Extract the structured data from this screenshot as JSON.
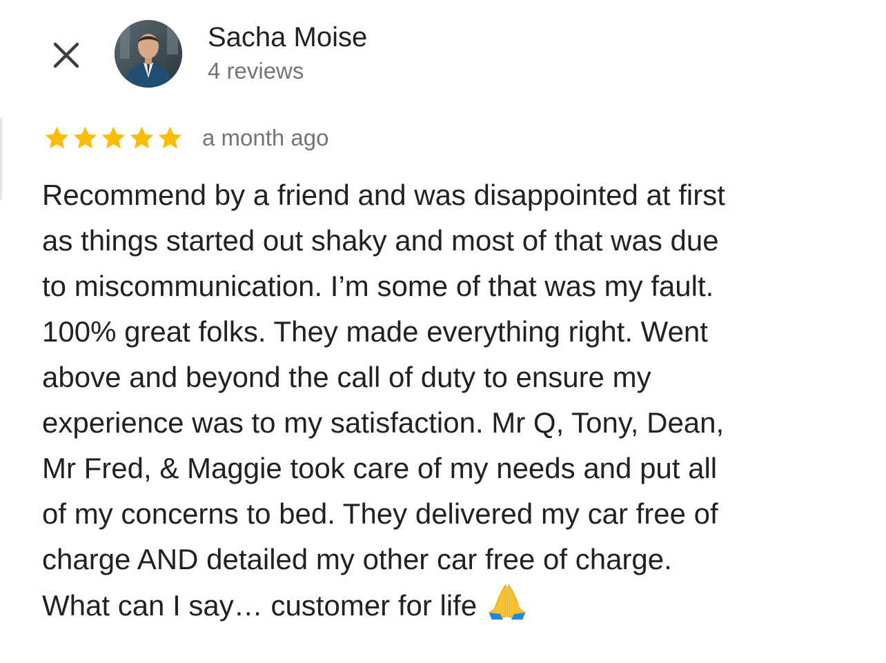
{
  "header": {
    "close_icon": "close-icon",
    "avatar_alt": "reviewer-avatar",
    "reviewer_name": "Sacha Moise",
    "review_count": "4 reviews"
  },
  "review": {
    "rating": 5,
    "rating_max": 5,
    "star_color": "#fbbc04",
    "timestamp": "a month ago",
    "lines": [
      "Recommend by a friend and was disappointed at first",
      "as things started out shaky and most of that was due",
      "to miscommunication. I’m some of that was my fault.",
      "100% great folks. They made everything right. Went",
      "above and beyond the call of duty to ensure my",
      "experience was to my satisfaction. Mr Q, Tony, Dean,",
      "Mr Fred, & Maggie took care of my needs and put all",
      "of my concerns to bed. They delivered my car free of",
      "charge AND detailed my other car free of charge.",
      "What can I say… customer for life"
    ],
    "emoji_icon": "folded-hands-icon"
  },
  "colors": {
    "text_primary": "#202124",
    "text_secondary": "#70757a",
    "background": "#ffffff"
  }
}
